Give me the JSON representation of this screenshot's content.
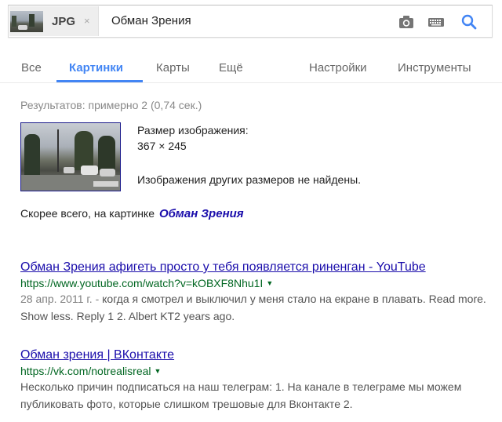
{
  "search": {
    "chip_label": "JPG",
    "chip_close": "×",
    "query": "Обман Зрения"
  },
  "tabs": [
    {
      "label": "Все"
    },
    {
      "label": "Картинки"
    },
    {
      "label": "Карты"
    },
    {
      "label": "Ещё"
    },
    {
      "label": "Настройки"
    },
    {
      "label": "Инструменты"
    }
  ],
  "colors": {
    "accent": "#4285f4",
    "link": "#1a0dab",
    "url_green": "#006621"
  },
  "results_stats": "Результатов: примерно 2 (0,74 сек.)",
  "image_info": {
    "size_label": "Размер изображения:",
    "size_value": "367 × 245",
    "no_sizes": "Изображения других размеров не найдены."
  },
  "best_guess": {
    "prefix": "Скорее всего, на картинке",
    "link": "Обман Зрения"
  },
  "results": [
    {
      "title": "Обман Зрения афигеть просто у тебя появляется риненган - YouTube",
      "url": "https://www.youtube.com/watch?v=kOBXF8Nhu1I",
      "date": "28 апр. 2011 г. - ",
      "snippet": "когда я смотрел и выключил у меня стало на екране в плавать. Read more. Show less. Reply 1 2. Albert KT2 years ago."
    },
    {
      "title": "Обман зрения | ВКонтакте",
      "url": "https://vk.com/notrealisreal",
      "date": "",
      "snippet": "Несколько причин подписаться на наш телеграм: 1. На канале в телеграме мы можем публиковать фото, которые слишком трешовые для Вконтакте 2."
    }
  ]
}
